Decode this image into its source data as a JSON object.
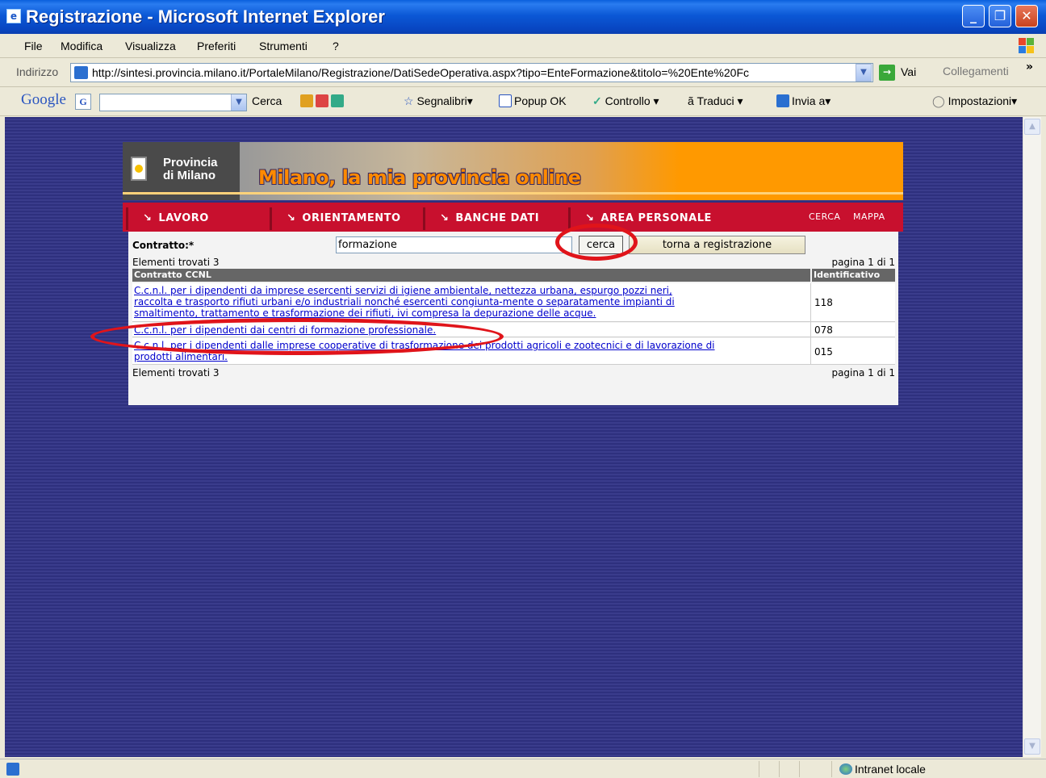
{
  "window": {
    "title": "Registrazione - Microsoft Internet Explorer",
    "minimize_label": "_",
    "maximize_label": "❐",
    "close_label": "✕"
  },
  "menu": [
    "File",
    "Modifica",
    "Visualizza",
    "Preferiti",
    "Strumenti",
    "?"
  ],
  "address": {
    "label": "Indirizzo",
    "url": "http://sintesi.provincia.milano.it/PortaleMilano/Registrazione/DatiSedeOperativa.aspx?tipo=EnteFormazione&titolo=%20Ente%20Fc",
    "go_label": "Vai",
    "links_label": "Collegamenti",
    "more": "»"
  },
  "google_bar": {
    "logo": "Google",
    "search_button": "Cerca",
    "bookmarks": "Segnalibri",
    "popup": "Popup OK",
    "spell": "Controllo",
    "translate": "Traduci",
    "send": "Invia a",
    "settings": "Impostazioni"
  },
  "site": {
    "brand_line1": "Provincia",
    "brand_line2": "di Milano",
    "slogan": "Milano, la mia provincia online",
    "nav": [
      "LAVORO",
      "ORIENTAMENTO",
      "BANCHE DATI",
      "AREA PERSONALE"
    ],
    "nav_arrow": "↘",
    "util_search": "CERCA",
    "util_map": "MAPPA"
  },
  "form": {
    "label": "Contratto:*",
    "value": "formazione",
    "search_button": "cerca",
    "back_button": "torna a registrazione"
  },
  "results": {
    "found_text": "Elementi trovati 3",
    "page_text": "pagina 1 di 1",
    "col_contract": "Contratto CCNL",
    "col_id": "Identificativo",
    "rows": [
      {
        "line1": "C.c.n.l. per i dipendenti da imprese esercenti servizi di igiene ambientale, nettezza urbana, espurgo pozzi neri,",
        "line2": "raccolta e trasporto rifiuti urbani e/o industriali nonché esercenti congiunta-mente o separatamente impianti di",
        "line3": "smaltimento, trattamento e trasformazione dei rifiuti, ivi compresa la depurazione delle acque.",
        "id": "118"
      },
      {
        "line1": "C.c.n.l. per i dipendenti dai centri di formazione professionale.",
        "id": "078"
      },
      {
        "line1": "C.c.n.l. per i dipendenti dalle imprese cooperative di trasformazione dei prodotti agricoli e zootecnici e di lavorazione di",
        "line2": "prodotti alimentari.",
        "id": "015"
      }
    ]
  },
  "status": {
    "zone": "Intranet locale"
  },
  "colors": {
    "nav_red": "#c8102e",
    "banner_orange": "#ff9900",
    "annotation_red": "#e0141a",
    "link_blue": "#0000cc"
  }
}
